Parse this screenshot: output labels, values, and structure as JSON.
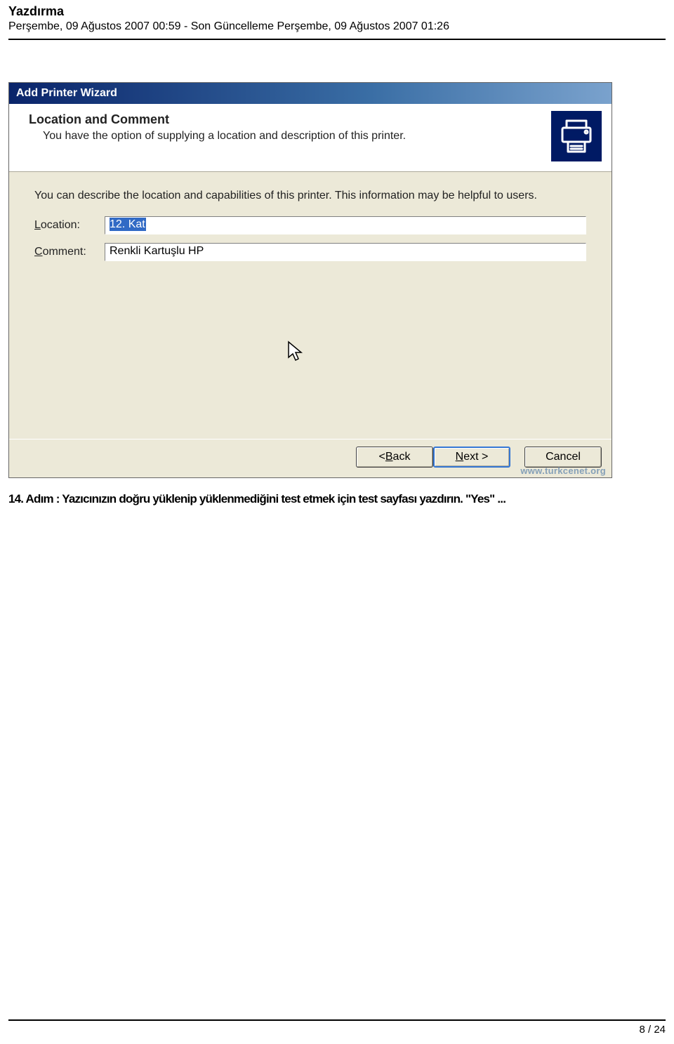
{
  "page": {
    "title": "Yazdırma",
    "dateline": "Perşembe, 09 Ağustos 2007 00:59 - Son Güncelleme Perşembe, 09 Ağustos 2007 01:26",
    "page_number": "8 / 24"
  },
  "wizard": {
    "window_title": "Add Printer Wizard",
    "step_title": "Location and Comment",
    "step_desc": "You have the option of supplying a location and description of this printer.",
    "instruction": "You can describe the location and capabilities of this printer. This information may be helpful to users.",
    "location_label_pre": "L",
    "location_label_post": "ocation:",
    "location_value": "12. Kat",
    "comment_label_pre": "C",
    "comment_label_post": "omment:",
    "comment_value": "Renkli Kartuşlu  HP",
    "back_pre": "< ",
    "back_mn": "B",
    "back_post": "ack",
    "next_mn": "N",
    "next_post": "ext >",
    "cancel_label": "Cancel",
    "watermark_url": "www.turkcenet.org"
  },
  "article_overlap": "14. Adım : Yazıcınızın doğru yüklenip yüklenmediğini test etmek için test sayfası yazdırın. \"Yes\" ..."
}
